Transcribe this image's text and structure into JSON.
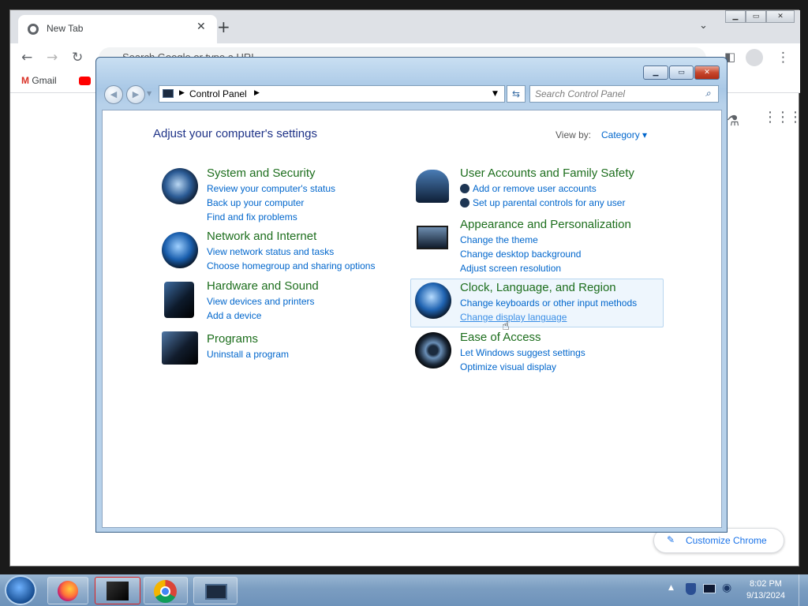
{
  "chrome": {
    "tab_title": "New Tab",
    "tab_close": "✕",
    "new_tab": "+",
    "tab_dropdown": "⌄",
    "omnibox_placeholder": "Search Google or type a URL",
    "bookmarks": [
      "Gmail"
    ],
    "customize_label": "Customize Chrome",
    "window_controls": [
      "minimize",
      "maximize",
      "close"
    ]
  },
  "control_panel": {
    "breadcrumb": "Control Panel",
    "search_placeholder": "Search Control Panel",
    "title": "Adjust your computer's settings",
    "view_by_label": "View by:",
    "view_by_value": "Category",
    "categories": [
      {
        "name": "System and Security",
        "links": [
          "Review your computer's status",
          "Back up your computer",
          "Find and fix problems"
        ]
      },
      {
        "name": "Network and Internet",
        "links": [
          "View network status and tasks",
          "Choose homegroup and sharing options"
        ]
      },
      {
        "name": "Hardware and Sound",
        "links": [
          "View devices and printers",
          "Add a device"
        ]
      },
      {
        "name": "Programs",
        "links": [
          "Uninstall a program"
        ]
      },
      {
        "name": "User Accounts and Family Safety",
        "links": [
          "Add or remove user accounts",
          "Set up parental controls for any user"
        ]
      },
      {
        "name": "Appearance and Personalization",
        "links": [
          "Change the theme",
          "Change desktop background",
          "Adjust screen resolution"
        ]
      },
      {
        "name": "Clock, Language, and Region",
        "links": [
          "Change keyboards or other input methods",
          "Change display language"
        ]
      },
      {
        "name": "Ease of Access",
        "links": [
          "Let Windows suggest settings",
          "Optimize visual display"
        ]
      }
    ],
    "icon_names": [
      "system-security-icon",
      "network-internet-icon",
      "hardware-sound-icon",
      "programs-icon",
      "user-accounts-icon",
      "appearance-icon",
      "clock-region-icon",
      "ease-of-access-icon"
    ]
  },
  "taskbar": {
    "time": "8:02 PM",
    "date": "9/13/2024",
    "apps": [
      "firefox",
      "control-panel",
      "chrome",
      "control-panel-window"
    ]
  },
  "colors": {
    "link": "#0066cc",
    "category_heading": "#1d6e1d",
    "title": "#1e3287",
    "taskbar": "#7b9dc1"
  }
}
